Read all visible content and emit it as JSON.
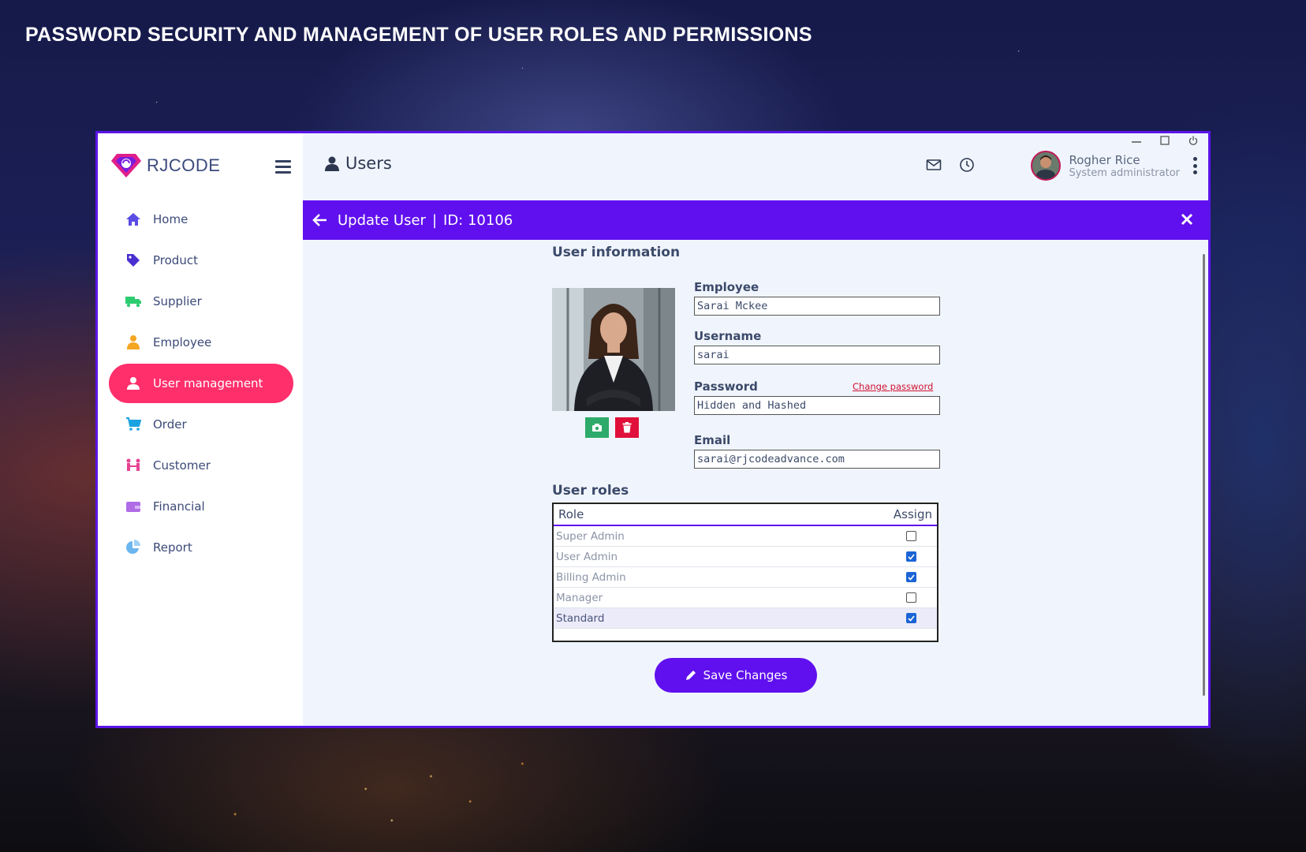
{
  "headline": "PASSWORD SECURITY AND MANAGEMENT OF USER ROLES AND PERMISSIONS",
  "brand": {
    "name": "RJCODE"
  },
  "sidebar": {
    "items": [
      {
        "label": "Home",
        "icon": "home-icon",
        "color": "#5b4ce6"
      },
      {
        "label": "Product",
        "icon": "tag-icon",
        "color": "#4a2fd0"
      },
      {
        "label": "Supplier",
        "icon": "truck-icon",
        "color": "#2ecc71"
      },
      {
        "label": "Employee",
        "icon": "employee-icon",
        "color": "#f5a623"
      },
      {
        "label": "User management",
        "icon": "user-icon",
        "active": true
      },
      {
        "label": "Order",
        "icon": "cart-icon",
        "color": "#1aa3e0"
      },
      {
        "label": "Customer",
        "icon": "customers-icon",
        "color": "#e84393"
      },
      {
        "label": "Financial",
        "icon": "wallet-icon",
        "color": "#b06ce6"
      },
      {
        "label": "Report",
        "icon": "pie-chart-icon",
        "color": "#6cb6f0"
      }
    ]
  },
  "header": {
    "title": "Users",
    "user": {
      "name": "Rogher Rice",
      "role": "System administrator"
    }
  },
  "banner": {
    "title": "Update User",
    "id_text": "ID: 10106"
  },
  "form": {
    "section_title": "User information",
    "employee": {
      "label": "Employee",
      "value": "Sarai Mckee"
    },
    "username": {
      "label": "Username",
      "value": "sarai"
    },
    "password": {
      "label": "Password",
      "value": "Hidden and Hashed",
      "change_link": "Change password"
    },
    "email": {
      "label": "Email",
      "value": "sarai@rjcodeadvance.com"
    }
  },
  "roles": {
    "section_title": "User roles",
    "columns": [
      "Role",
      "Assign"
    ],
    "rows": [
      {
        "role": "Super Admin",
        "assigned": false
      },
      {
        "role": "User Admin",
        "assigned": true
      },
      {
        "role": "Billing Admin",
        "assigned": true
      },
      {
        "role": "Manager",
        "assigned": false
      },
      {
        "role": "Standard",
        "assigned": true,
        "selected": true
      }
    ]
  },
  "save_button": "Save Changes",
  "colors": {
    "accent": "#6010ee",
    "active": "#ff2f6b",
    "danger": "#e0103a",
    "success": "#2eaa6a"
  }
}
